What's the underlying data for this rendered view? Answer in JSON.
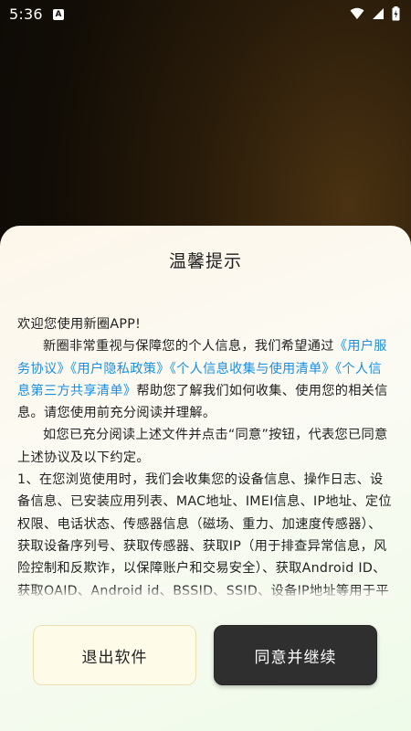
{
  "status_bar": {
    "time": "5:36",
    "notification_icon": "A",
    "icons": [
      "wifi-icon",
      "signal-icon",
      "battery-icon"
    ]
  },
  "dialog": {
    "title": "温馨提示",
    "greeting": "欢迎您使用新圈APP!",
    "para1_before": "新圈非常重视与保障您的个人信息，我们希望通过",
    "link_service": "《用户服务协议》",
    "link_privacy": "《用户隐私政策》",
    "link_collect": "《个人信息收集与使用清单》",
    "link_thirdparty": "《个人信息第三方共享清单》",
    "para1_after": "帮助您了解我们如何收集、使用您的相关信息。请您使用前充分阅读并理解。",
    "para2": "如您已充分阅读上述文件并点击“同意”按钮，代表您已同意上述协议及以下约定。",
    "para3": "1、在您浏览使用时，我们会收集您的设备信息、操作日志、设备信息、已安装应用列表、MAC地址、IMEI信息、IP地址、定位权限、电话状态、传感器信息（磁场、重力、加速度传感器）、获取设备序列号、获取传感器、获取IP（用于排查异常信息，风险控制和反欺诈，以保障账户和交易安全）、获取Android ID、获取OAID、Android id、BSSID、SSID、设备IP地址等用于平台安全",
    "exit_button": "退出软件",
    "agree_button": "同意并继续"
  },
  "colors": {
    "link": "#1a8fe3",
    "agree_button_bg": "#2f2f2f",
    "exit_button_bg": "#fefbe8"
  }
}
